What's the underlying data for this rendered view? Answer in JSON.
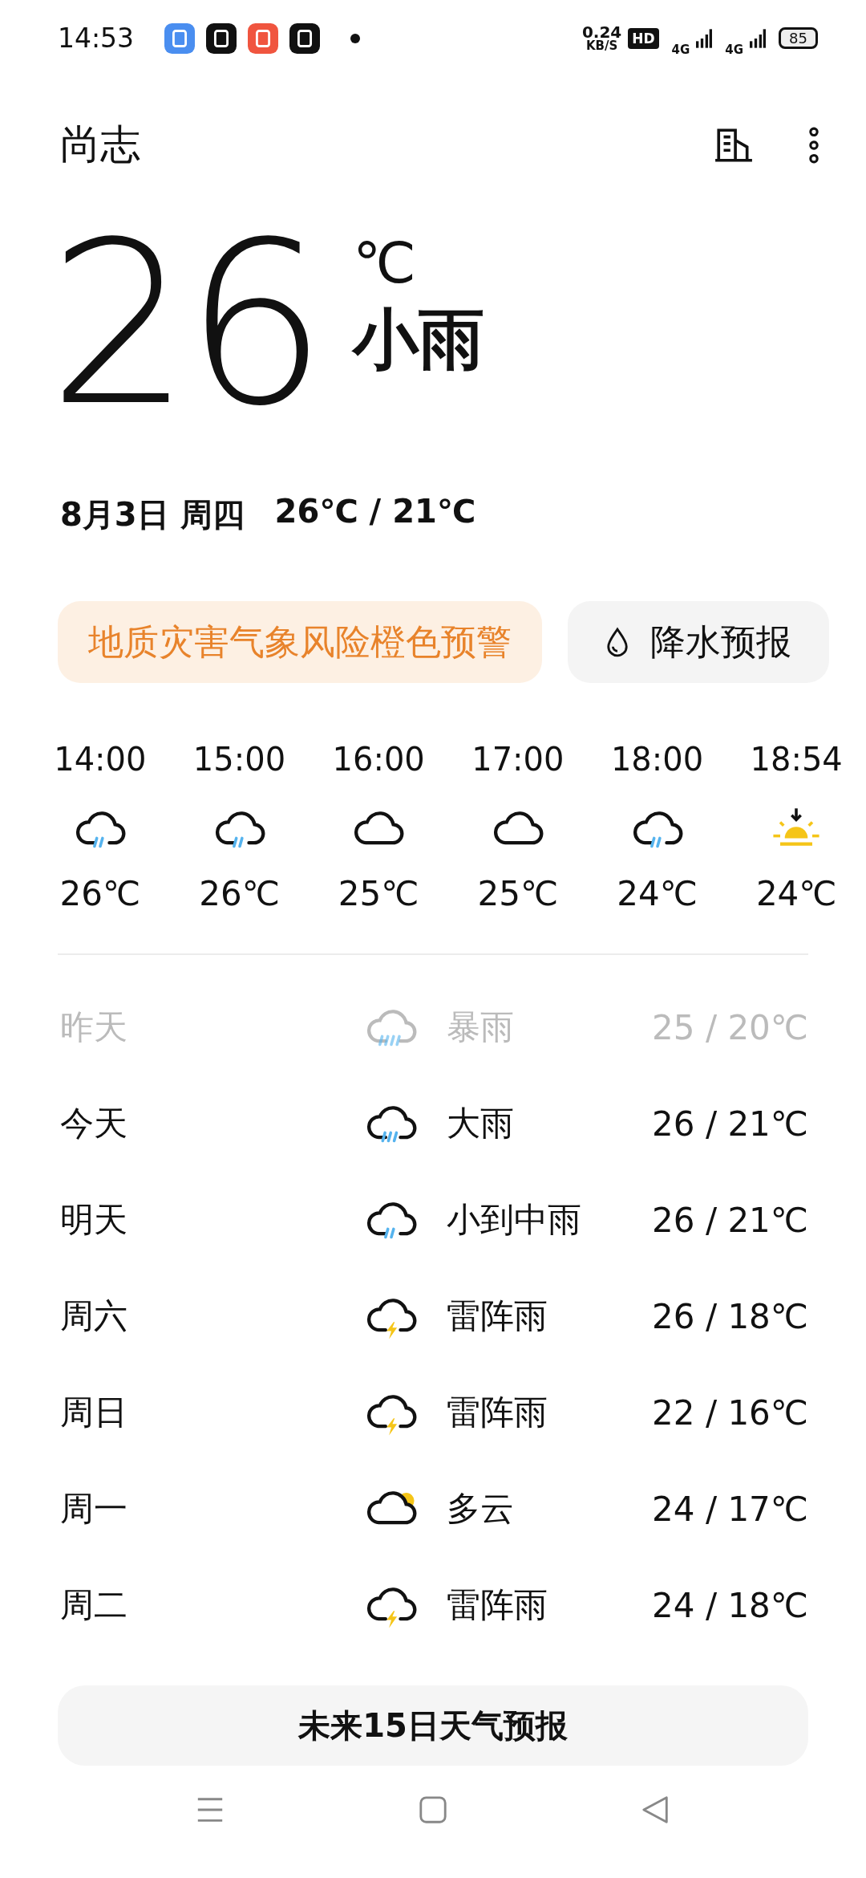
{
  "status_bar": {
    "time": "14:53",
    "apps": [
      {
        "color": "#4a8ef0"
      },
      {
        "color": "#111111"
      },
      {
        "color": "#f0553f"
      },
      {
        "color": "#111111"
      }
    ],
    "speed": "0.24",
    "speed_unit": "KB/S",
    "hd": "HD",
    "networks": [
      "4G",
      "4G"
    ],
    "battery": "85"
  },
  "header": {
    "city": "尚志"
  },
  "current": {
    "temp": "26",
    "unit": "℃",
    "condition": "小雨",
    "date": "8月3日 周四",
    "range": "26℃ / 21℃"
  },
  "alert": {
    "text": "地质灾害气象风险橙色预警"
  },
  "precip_button": {
    "label": "降水预报"
  },
  "hourly": [
    {
      "time": "14:00",
      "kind": "light-rain",
      "temp": "26℃"
    },
    {
      "time": "15:00",
      "kind": "light-rain",
      "temp": "26℃"
    },
    {
      "time": "16:00",
      "kind": "cloudy",
      "temp": "25℃"
    },
    {
      "time": "17:00",
      "kind": "cloudy",
      "temp": "25℃"
    },
    {
      "time": "18:00",
      "kind": "light-rain",
      "temp": "24℃"
    },
    {
      "time": "18:54",
      "kind": "sunset",
      "temp": "24℃"
    }
  ],
  "daily": [
    {
      "day": "昨天",
      "kind": "storm",
      "condition": "暴雨",
      "range": "25 / 20℃",
      "past": true
    },
    {
      "day": "今天",
      "kind": "heavy-rain",
      "condition": "大雨",
      "range": "26 / 21℃",
      "past": false
    },
    {
      "day": "明天",
      "kind": "light-rain",
      "condition": "小到中雨",
      "range": "26 / 21℃",
      "past": false
    },
    {
      "day": "周六",
      "kind": "thunder",
      "condition": "雷阵雨",
      "range": "26 / 18℃",
      "past": false
    },
    {
      "day": "周日",
      "kind": "thunder",
      "condition": "雷阵雨",
      "range": "22 / 16℃",
      "past": false
    },
    {
      "day": "周一",
      "kind": "partly-cloudy",
      "condition": "多云",
      "range": "24 / 17℃",
      "past": false
    },
    {
      "day": "周二",
      "kind": "thunder",
      "condition": "雷阵雨",
      "range": "24 / 18℃",
      "past": false
    }
  ],
  "forecast_button": {
    "label": "未来15日天气预报"
  }
}
